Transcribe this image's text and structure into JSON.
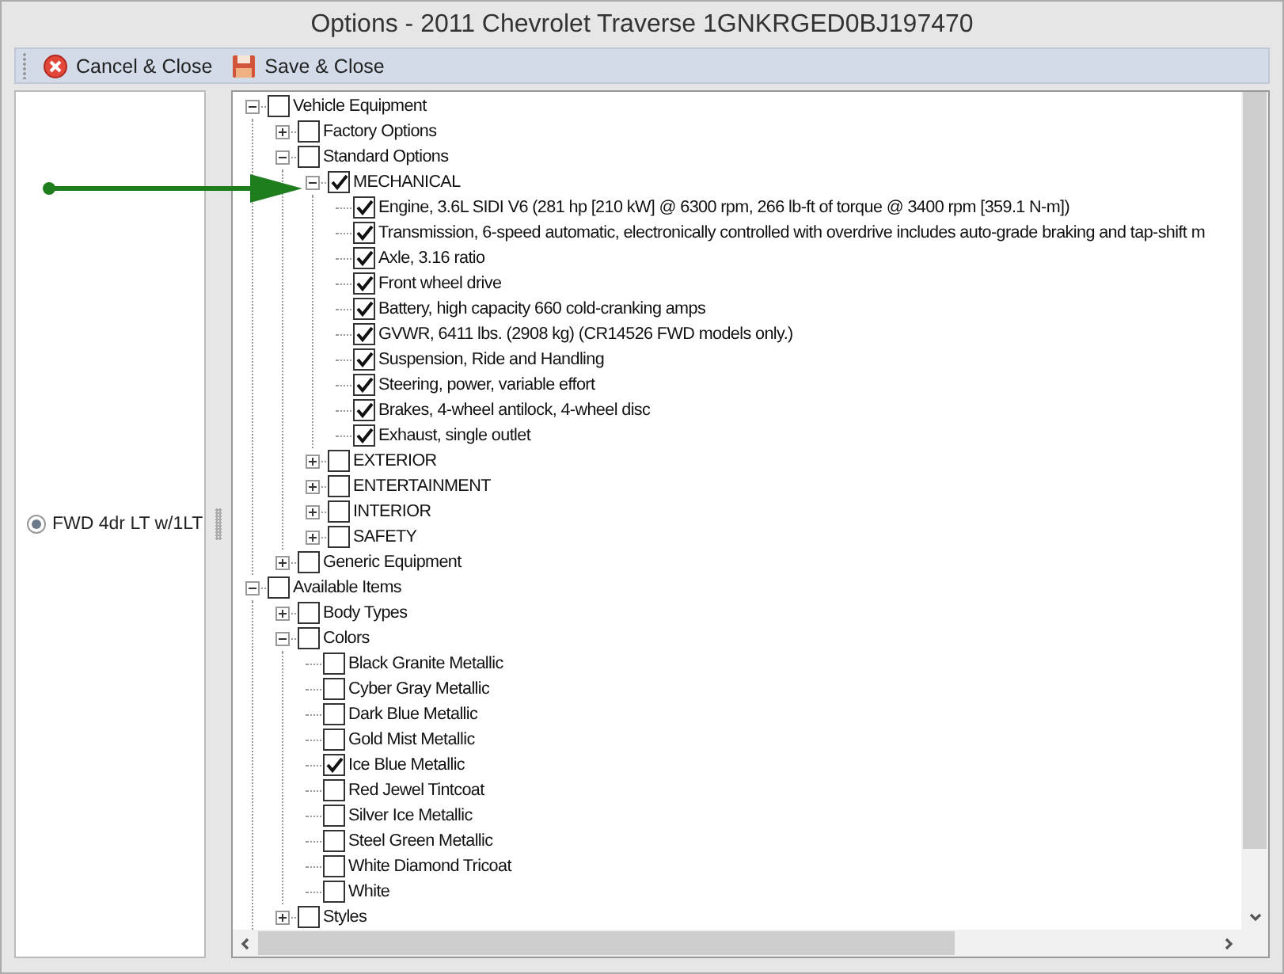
{
  "window": {
    "title": "Options - 2011 Chevrolet Traverse 1GNKRGED0BJ197470"
  },
  "toolbar": {
    "buttons": [
      {
        "kind": "cancel",
        "label": "Cancel & Close"
      },
      {
        "kind": "save",
        "label": "Save & Close"
      }
    ]
  },
  "trims": [
    {
      "label": "FWD 4dr LT w/1LT",
      "selected": true
    }
  ],
  "tree": [
    {
      "label": "Vehicle Equipment",
      "checked": false,
      "expanded": true,
      "children": [
        {
          "label": "Factory Options",
          "checked": false,
          "expanded": false
        },
        {
          "label": "Standard Options",
          "checked": false,
          "expanded": true,
          "children": [
            {
              "label": "MECHANICAL",
              "checked": true,
              "expanded": true,
              "children": [
                {
                  "label": "Engine, 3.6L SIDI V6 (281 hp [210 kW] @ 6300 rpm, 266 lb-ft of torque @ 3400 rpm [359.1 N-m])",
                  "checked": true
                },
                {
                  "label": "Transmission, 6-speed automatic, electronically controlled with overdrive includes auto-grade braking and tap-shift m",
                  "checked": true
                },
                {
                  "label": "Axle, 3.16 ratio",
                  "checked": true
                },
                {
                  "label": "Front wheel drive",
                  "checked": true
                },
                {
                  "label": "Battery, high capacity 660 cold-cranking amps",
                  "checked": true
                },
                {
                  "label": "GVWR, 6411 lbs. (2908 kg) (CR14526 FWD models only.)",
                  "checked": true
                },
                {
                  "label": "Suspension, Ride and Handling",
                  "checked": true
                },
                {
                  "label": "Steering, power, variable effort",
                  "checked": true
                },
                {
                  "label": "Brakes, 4-wheel antilock, 4-wheel disc",
                  "checked": true
                },
                {
                  "label": "Exhaust, single outlet",
                  "checked": true
                }
              ]
            },
            {
              "label": "EXTERIOR",
              "checked": false,
              "expanded": false
            },
            {
              "label": "ENTERTAINMENT",
              "checked": false,
              "expanded": false
            },
            {
              "label": "INTERIOR",
              "checked": false,
              "expanded": false
            },
            {
              "label": "SAFETY",
              "checked": false,
              "expanded": false
            }
          ]
        },
        {
          "label": "Generic Equipment",
          "checked": false,
          "expanded": false
        }
      ]
    },
    {
      "label": "Available Items",
      "checked": false,
      "expanded": true,
      "children": [
        {
          "label": "Body Types",
          "checked": false,
          "expanded": false
        },
        {
          "label": "Colors",
          "checked": false,
          "expanded": true,
          "children": [
            {
              "label": "Black Granite Metallic",
              "checked": false
            },
            {
              "label": "Cyber Gray Metallic",
              "checked": false
            },
            {
              "label": "Dark Blue Metallic",
              "checked": false
            },
            {
              "label": "Gold Mist Metallic",
              "checked": false
            },
            {
              "label": "Ice Blue Metallic",
              "checked": true
            },
            {
              "label": "Red Jewel Tintcoat",
              "checked": false
            },
            {
              "label": "Silver Ice Metallic",
              "checked": false
            },
            {
              "label": "Steel Green Metallic",
              "checked": false
            },
            {
              "label": "White Diamond Tricoat",
              "checked": false
            },
            {
              "label": "White",
              "checked": false
            }
          ]
        },
        {
          "label": "Styles",
          "checked": false,
          "expanded": false
        }
      ]
    }
  ]
}
